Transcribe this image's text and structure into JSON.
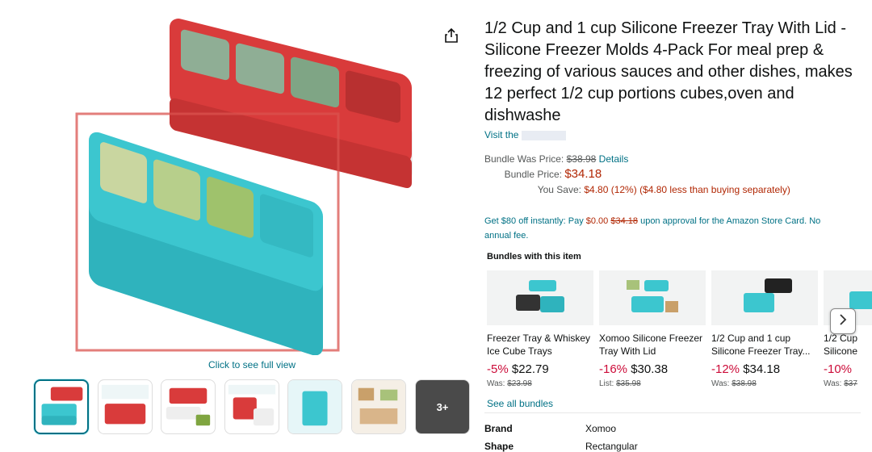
{
  "product": {
    "title": "1/2 Cup and 1 cup Silicone Freezer Tray With Lid - Silicone Freezer Molds 4-Pack For meal prep & freezing of various sauces and other dishes, makes 12 perfect 1/2 cup portions cubes,oven and dishwashe",
    "visit_prefix": "Visit the"
  },
  "gallery": {
    "see_full_view": "Click to see full view",
    "more_label": "3+"
  },
  "pricing": {
    "bundle_was_label": "Bundle Was Price:",
    "bundle_was_value": "$38.98",
    "details_link": "Details",
    "bundle_price_label": "Bundle Price:",
    "bundle_price_value": "$34.18",
    "you_save_label": "You Save:",
    "you_save_value": "$4.80 (12%)",
    "you_save_note": "($4.80 less than buying separately)"
  },
  "card_offer": {
    "prefix": "Get $80 off instantly: Pay",
    "pay_amount": "$0.00",
    "struck_amount": "$34.18",
    "suffix": "upon approval for the Amazon Store Card. No annual fee."
  },
  "bundles": {
    "heading": "Bundles with this item",
    "items": [
      {
        "name": "Freezer Tray & Whiskey Ice Cube Trays",
        "pct": "-5%",
        "price": "$22.79",
        "was_label": "Was:",
        "was": "$23.98"
      },
      {
        "name": "Xomoo Silicone Freezer Tray With Lid",
        "pct": "-16%",
        "price": "$30.38",
        "was_label": "List:",
        "was": "$35.98"
      },
      {
        "name": "1/2 Cup and 1 cup Silicone Freezer Tray...",
        "pct": "-12%",
        "price": "$34.18",
        "was_label": "Was:",
        "was": "$38.98"
      },
      {
        "name": "1/2 Cup Silicone",
        "pct": "-10%",
        "price": "",
        "was_label": "Was:",
        "was": "$37"
      }
    ],
    "see_all": "See all bundles"
  },
  "specs": [
    {
      "key": "Brand",
      "value": "Xomoo"
    },
    {
      "key": "Shape",
      "value": "Rectangular"
    }
  ],
  "colors": {
    "link": "#007185",
    "price_red": "#B12704",
    "discount_red": "#CC0C39",
    "tray_teal": "#3cc6cf",
    "tray_red": "#d93b3b"
  },
  "icons": [
    "share-icon",
    "chevron-right-icon"
  ]
}
